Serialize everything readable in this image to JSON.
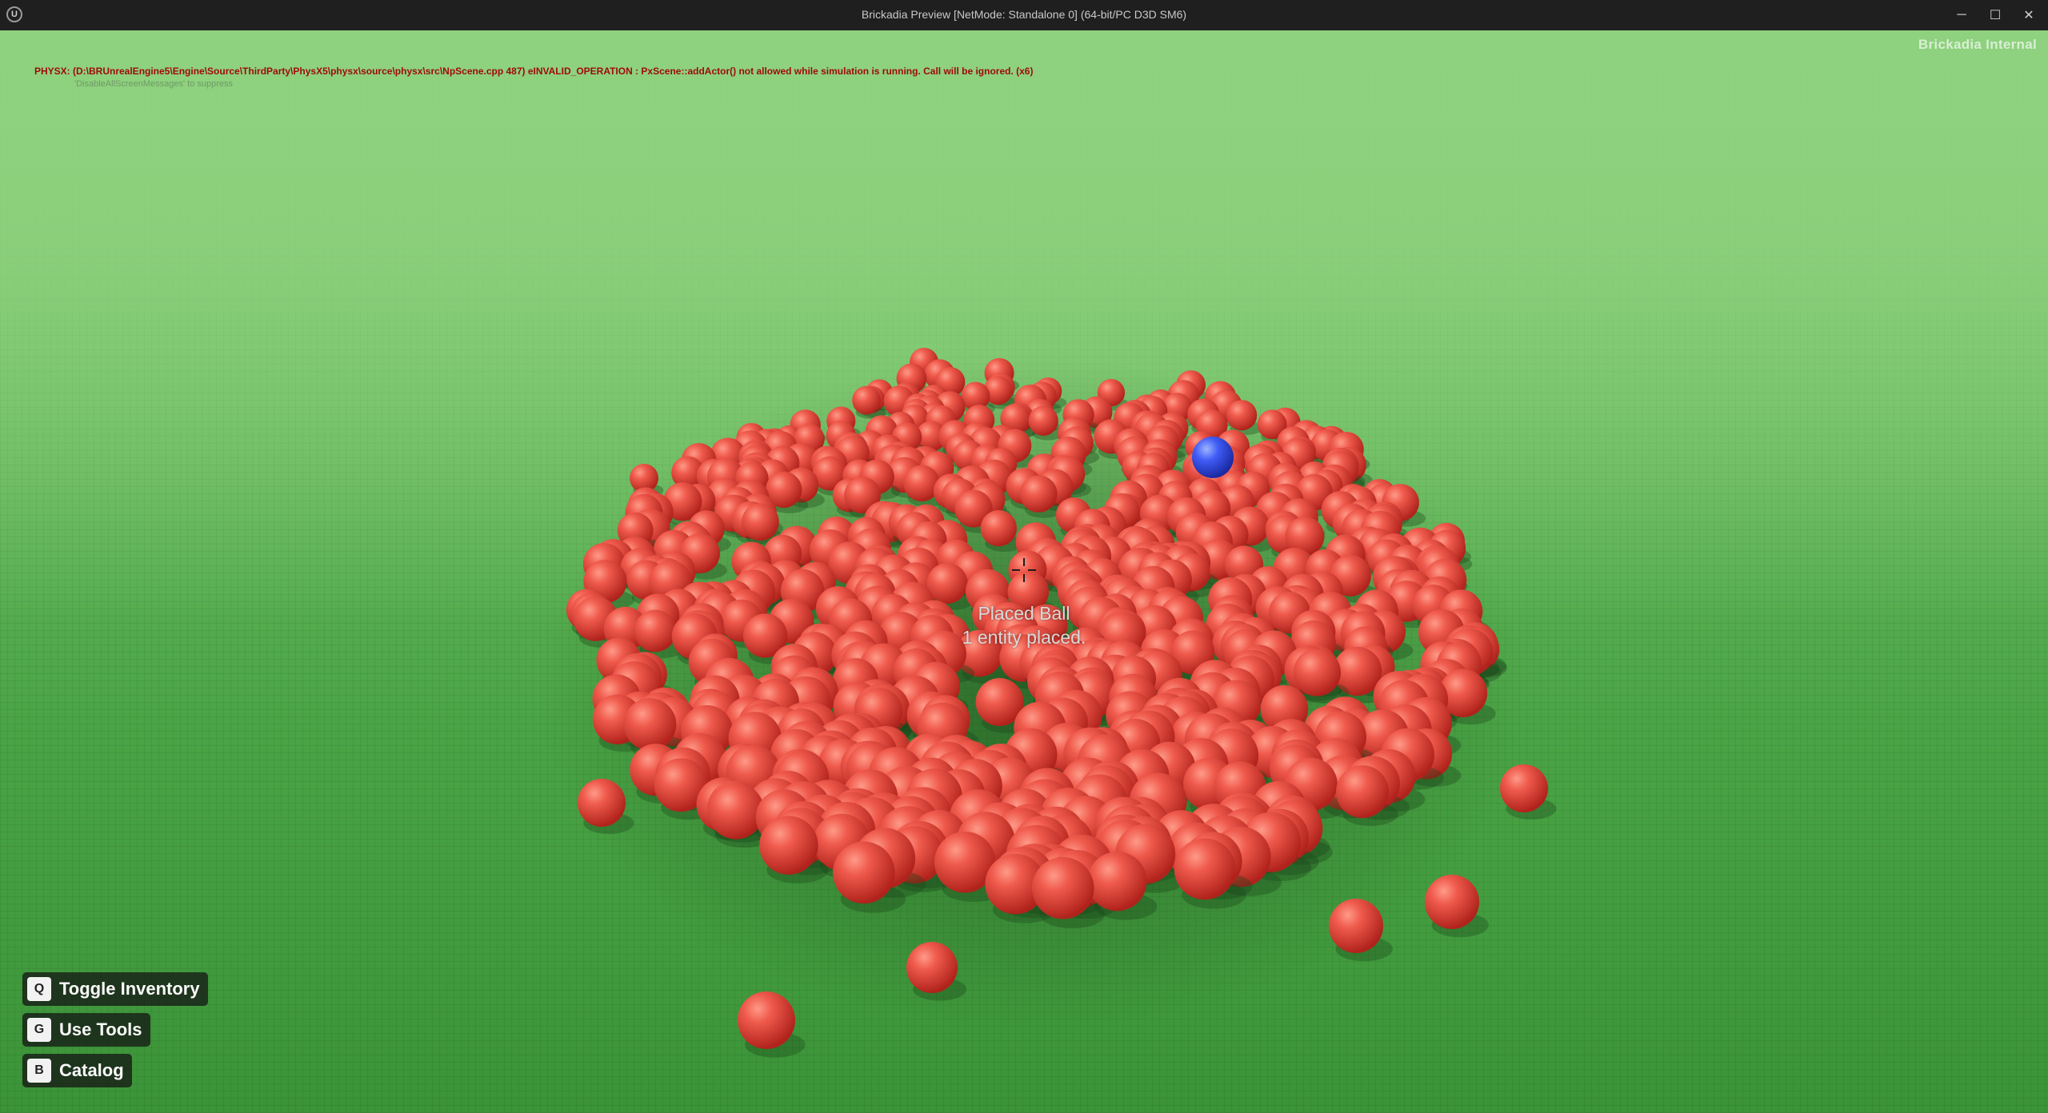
{
  "window": {
    "title": "Brickadia Preview [NetMode: Standalone 0]  (64-bit/PC D3D SM6)",
    "logo_text": "U",
    "minimize_glyph": "─",
    "maximize_glyph": "☐",
    "close_glyph": "✕"
  },
  "overlay": {
    "watermark": "Brickadia Internal",
    "error_line": "PHYSX: (D:\\BRUnrealEngine5\\Engine\\Source\\ThirdParty\\PhysX5\\physx\\source\\physx\\src\\NpScene.cpp 487) eINVALID_OPERATION : PxScene::addActor() not allowed while simulation is running. Call will be ignored. (x6)",
    "error_hint": "'DisableAllScreenMessages' to suppress",
    "toast_title": "Placed Ball",
    "toast_detail": "1 entity placed."
  },
  "hints": [
    {
      "key": "Q",
      "label": "Toggle Inventory"
    },
    {
      "key": "G",
      "label": "Use Tools"
    },
    {
      "key": "B",
      "label": "Catalog"
    }
  ],
  "colors": {
    "ball_red": "#e8463c",
    "ball_blue": "#2f4cf0",
    "ground": "#5fb457"
  },
  "icons": {
    "crosshair": "crosshair-icon",
    "engine_logo": "unreal-logo-icon"
  }
}
